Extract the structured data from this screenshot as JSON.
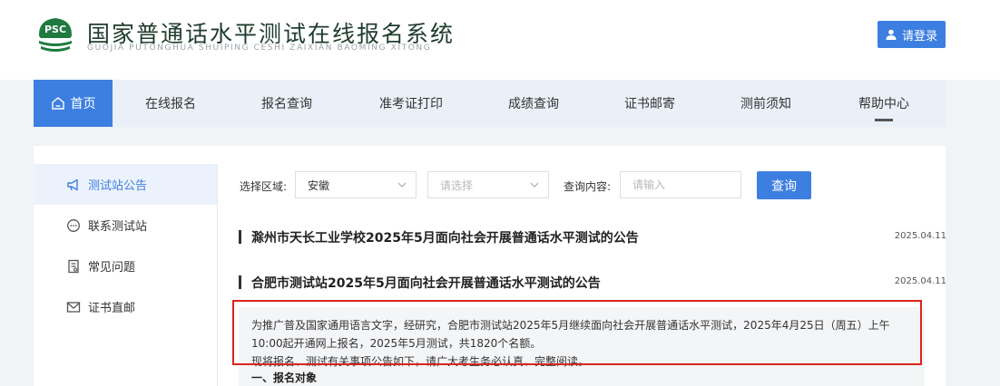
{
  "header": {
    "logo_text": "PSC",
    "title": "国家普通话水平测试在线报名系统",
    "subtitle": "GUOJIA PUTONGHUA SHUIPING CESHI ZAIXIAN BAOMING XITONG",
    "login_label": "请登录"
  },
  "nav": {
    "items": [
      "首页",
      "在线报名",
      "报名查询",
      "准考证打印",
      "成绩查询",
      "证书邮寄",
      "测前须知",
      "帮助中心"
    ],
    "active": "首页"
  },
  "sidebar": {
    "items": [
      "测试站公告",
      "联系测试站",
      "常见问题",
      "证书直邮"
    ]
  },
  "filters": {
    "region_label": "选择区域:",
    "region_value": "安徽",
    "city_placeholder": "请选择",
    "content_label": "查询内容:",
    "content_placeholder": "请输入",
    "query_label": "查询"
  },
  "notices": [
    {
      "title": "滁州市天长工业学校2025年5月面向社会开展普通话水平测试的公告",
      "date": "2025.04.11"
    },
    {
      "title": "合肥市测试站2025年5月面向社会开展普通话水平测试的公告",
      "date": "2025.04.11"
    }
  ],
  "notice_body": {
    "paragraph1": "为推广普及国家通用语言文字，经研究，合肥市测试站2025年5月继续面向社会开展普通话水平测试，2025年4月25日（周五）上午10:00起开通网上报名，2025年5月测试，共1820个名额。",
    "paragraph2": "现将报名、测试有关事项公告如下，请广大考生务必认真、完整阅读。",
    "section1": "一、报名对象"
  },
  "colors": {
    "primary": "#3d7fe0",
    "nav_bg": "#eaf0f8",
    "highlight": "#d9241c"
  }
}
